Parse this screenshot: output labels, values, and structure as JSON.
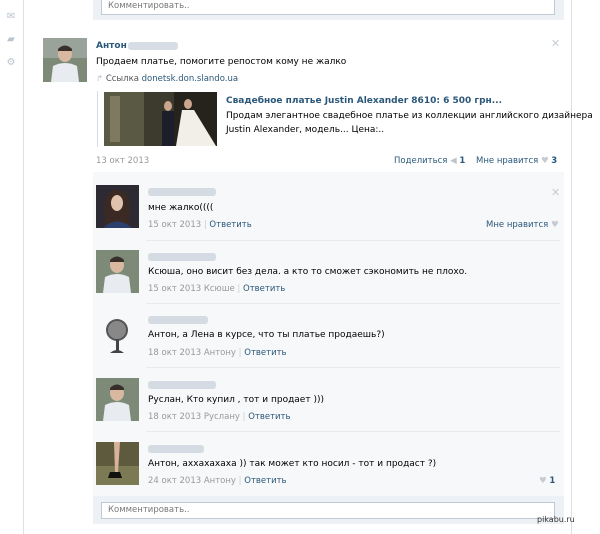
{
  "comment_placeholder": "Комментировать..",
  "post": {
    "author": "Антон",
    "text": "Продаем платье, помогите репостом кому не жалко",
    "link_prefix": "Ссылка",
    "link_domain": "donetsk.don.slando.ua",
    "attachment_title": "Свадебное платье Justin Alexander 8610: 6 500 грн...",
    "attachment_desc_line1": "Продам элегантное свадебное платье из коллекции английского дизайнера",
    "attachment_desc_line2": "Justin Alexander, модель... Цена:..",
    "date": "13 окт 2013",
    "share_label": "Поделиться",
    "share_count": "1",
    "like_label": "Мне нравится",
    "like_count": "3"
  },
  "replies": [
    {
      "text": "мне жалко((((",
      "date": "15 окт 2013",
      "to": "",
      "reply_label": "Ответить",
      "like_label": "Мне нравится",
      "like_count": ""
    },
    {
      "text": "Ксюша, оно висит без дела. а кто то сможет сэкономить не плохо.",
      "date": "15 окт 2013",
      "to": "Ксюше",
      "reply_label": "Ответить",
      "like_label": "",
      "like_count": ""
    },
    {
      "text": "Антон, а Лена в курсе, что ты платье продаешь?)",
      "date": "18 окт 2013",
      "to": "Антону",
      "reply_label": "Ответить",
      "like_label": "",
      "like_count": ""
    },
    {
      "text": "Руслан, Кто купил , тот и продает )))",
      "date": "18 окт 2013",
      "to": "Руслану",
      "reply_label": "Ответить",
      "like_label": "",
      "like_count": ""
    },
    {
      "text": "Антон, ахха­хахаха )) так может кто носил - тот и продаст ?)",
      "date": "24 окт 2013",
      "to": "Антону",
      "reply_label": "Ответить",
      "like_label": "",
      "like_count": "1"
    }
  ],
  "watermark": "pikabu.ru",
  "icons": [
    "mail-icon",
    "comment-icon",
    "settings-icon",
    "share-icon",
    "heart-icon",
    "close-icon",
    "link-icon"
  ],
  "colors": {
    "link": "#2b587a",
    "meta": "#999999",
    "panel": "#edf1f5"
  }
}
